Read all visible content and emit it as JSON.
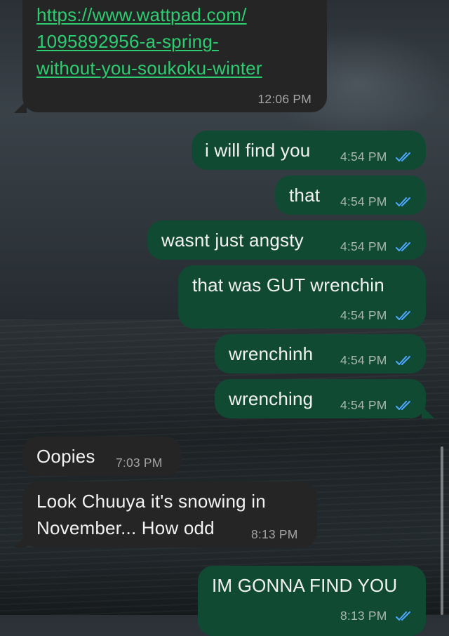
{
  "messages": [
    {
      "id": "m0",
      "dir": "in",
      "lines": [
        "https://www.wattpad.com/",
        "1095892956-a-spring-",
        "without-you-soukoku-winter"
      ],
      "time": "12:06 PM",
      "link": true
    },
    {
      "id": "m1",
      "dir": "out",
      "text": "i will find you",
      "time": "4:54 PM",
      "read": true
    },
    {
      "id": "m2",
      "dir": "out",
      "text": "that",
      "time": "4:54 PM",
      "read": true
    },
    {
      "id": "m3",
      "dir": "out",
      "text": "wasnt just angsty",
      "time": "4:54 PM",
      "read": true
    },
    {
      "id": "m4",
      "dir": "out",
      "text": "that was GUT wrenchin",
      "time": "4:54 PM",
      "read": true
    },
    {
      "id": "m5",
      "dir": "out",
      "text": "wrenchinh",
      "time": "4:54 PM",
      "read": true
    },
    {
      "id": "m6",
      "dir": "out",
      "text": "wrenching",
      "time": "4:54 PM",
      "read": true
    },
    {
      "id": "m7",
      "dir": "in",
      "text": "Oopies",
      "time": "7:03 PM"
    },
    {
      "id": "m8",
      "dir": "in",
      "lines": [
        "Look Chuuya it's snowing in",
        "November... How odd"
      ],
      "time": "8:13 PM"
    },
    {
      "id": "m9",
      "dir": "out",
      "text": "IM GONNA FIND YOU",
      "time": "8:13 PM",
      "read": true
    }
  ],
  "colors": {
    "incoming": "#252525",
    "outgoing": "#114a33",
    "link": "#2ecc71",
    "read_ticks": "#4fa8ff"
  },
  "icons": {
    "read_receipt": "double-check-icon"
  }
}
